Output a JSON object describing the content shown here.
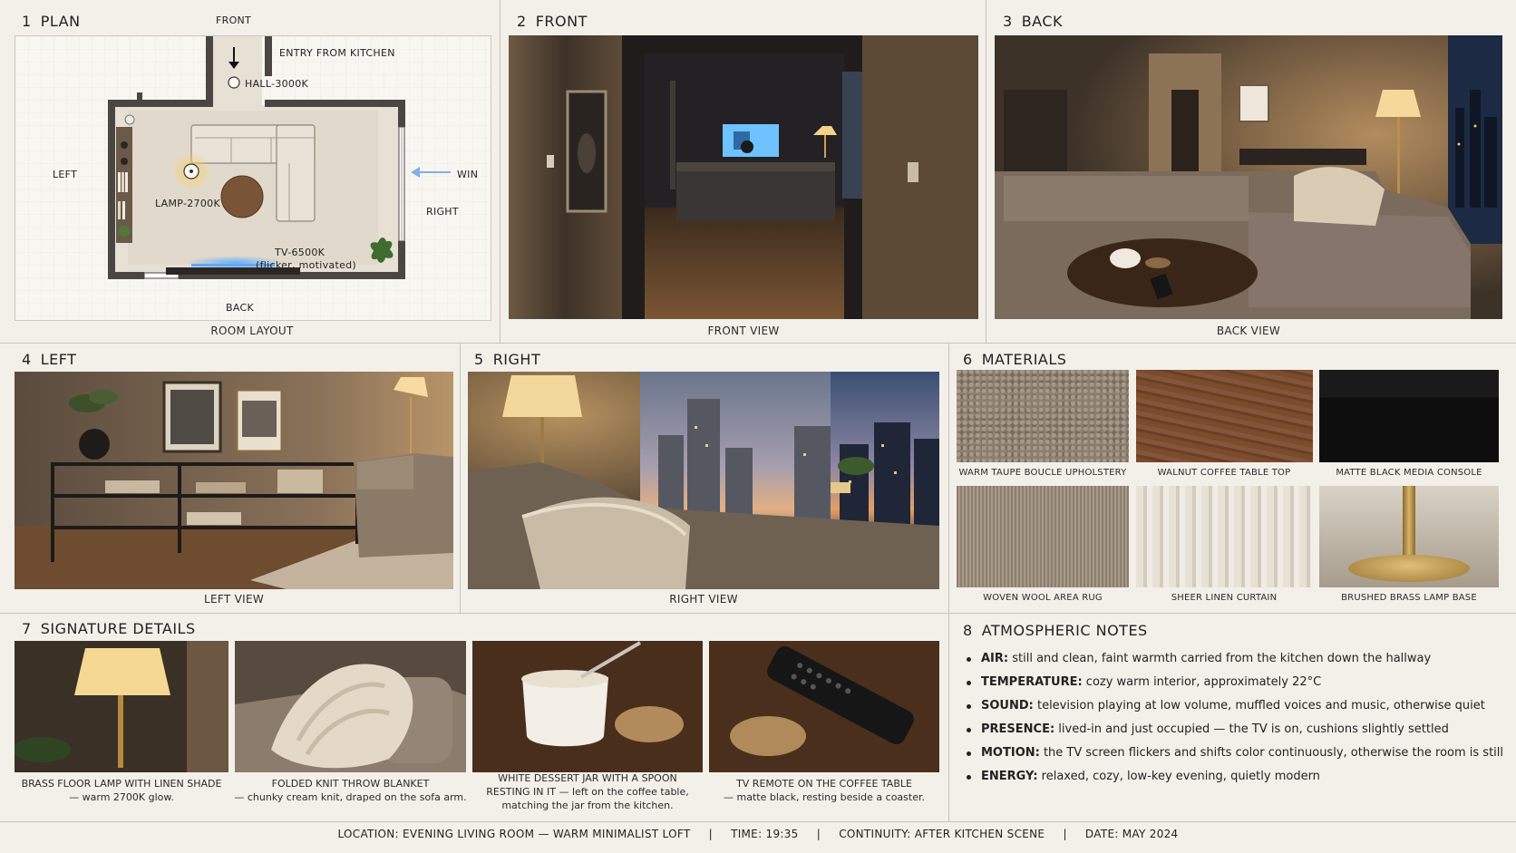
{
  "panels": {
    "plan": {
      "num": "1",
      "title": "PLAN",
      "caption": "ROOM LAYOUT"
    },
    "front": {
      "num": "2",
      "title": "FRONT",
      "caption": "FRONT VIEW"
    },
    "back": {
      "num": "3",
      "title": "BACK",
      "caption": "BACK VIEW"
    },
    "left": {
      "num": "4",
      "title": "LEFT",
      "caption": "LEFT VIEW"
    },
    "right": {
      "num": "5",
      "title": "RIGHT",
      "caption": "RIGHT VIEW"
    },
    "materials": {
      "num": "6",
      "title": "MATERIALS"
    },
    "signature": {
      "num": "7",
      "title": "SIGNATURE DETAILS"
    },
    "atmosphere": {
      "num": "8",
      "title": "ATMOSPHERIC NOTES"
    }
  },
  "plan_labels": {
    "front": "FRONT",
    "entry": "ENTRY FROM KITCHEN",
    "hall": "HALL-3000K",
    "left": "LEFT",
    "win": "WIN",
    "right": "RIGHT",
    "lamp": "LAMP-2700K",
    "tv": "TV-6500K",
    "tv_note": "(flicker, motivated)",
    "back": "BACK"
  },
  "materials": [
    {
      "label": "WARM TAUPE BOUCLE UPHOLSTERY"
    },
    {
      "label": "WALNUT COFFEE TABLE TOP"
    },
    {
      "label": "MATTE BLACK MEDIA CONSOLE"
    },
    {
      "label": "WOVEN WOOL AREA RUG"
    },
    {
      "label": "SHEER LINEN CURTAIN"
    },
    {
      "label": "BRUSHED BRASS LAMP BASE"
    }
  ],
  "signature": [
    {
      "line1": "BRASS FLOOR LAMP WITH LINEN SHADE",
      "line2": "— warm 2700K glow.",
      "line3": ""
    },
    {
      "line1": "FOLDED KNIT THROW BLANKET",
      "line2": "— chunky cream knit, draped on the sofa arm.",
      "line3": ""
    },
    {
      "line1": "WHITE DESSERT JAR WITH A SPOON",
      "line2": "RESTING IN IT — left on the coffee table,",
      "line3": "matching the jar from the kitchen."
    },
    {
      "line1": "TV REMOTE ON THE COFFEE TABLE",
      "line2": "— matte black, resting beside a coaster.",
      "line3": ""
    }
  ],
  "notes": [
    {
      "key": "AIR:",
      "text": " still and clean, faint warmth carried from the kitchen down the hallway"
    },
    {
      "key": "TEMPERATURE:",
      "text": " cozy warm interior, approximately 22°C"
    },
    {
      "key": "SOUND:",
      "text": " television playing at low volume, muffled voices and music, otherwise quiet"
    },
    {
      "key": "PRESENCE:",
      "text": " lived-in and just occupied — the TV is on, cushions slightly settled"
    },
    {
      "key": "MOTION:",
      "text": " the TV screen flickers and shifts color continuously, otherwise the room is still"
    },
    {
      "key": "ENERGY:",
      "text": " relaxed, cozy, low-key evening, quietly modern"
    }
  ],
  "footer": {
    "location": "LOCATION: EVENING LIVING ROOM — WARM MINIMALIST LOFT",
    "time": "TIME: 19:35",
    "continuity": "CONTINUITY: AFTER KITCHEN SCENE",
    "date": "DATE: MAY 2024",
    "sep": "|"
  },
  "colors": {
    "background": "#f3f0ea",
    "rule": "#c9c4bb",
    "wall": "#4a4642",
    "tv_glow": "#5aa9ff",
    "lamp_glow": "#f5c85a",
    "window_arrow": "#7fb0e6"
  }
}
